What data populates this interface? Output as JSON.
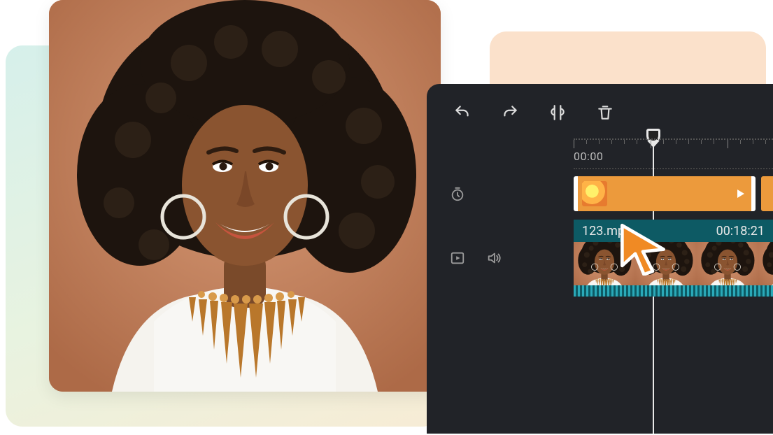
{
  "timeline": {
    "ruler": {
      "start_label": "00:00"
    },
    "effect_track": {
      "icon": "timer-icon"
    },
    "video_track": {
      "clip_filename": "123.mp",
      "clip_timecode": "00:18:21",
      "play_icon": "play-box-icon",
      "speaker_icon": "speaker-icon"
    }
  },
  "toolbar": {
    "undo": "undo-icon",
    "redo": "redo-icon",
    "split": "split-icon",
    "delete": "trash-icon"
  },
  "colors": {
    "accent_orange": "#f08a24",
    "panel_bg": "#212328",
    "clip_teal": "#0d5a64",
    "effect_orange": "#ec9a3c"
  }
}
